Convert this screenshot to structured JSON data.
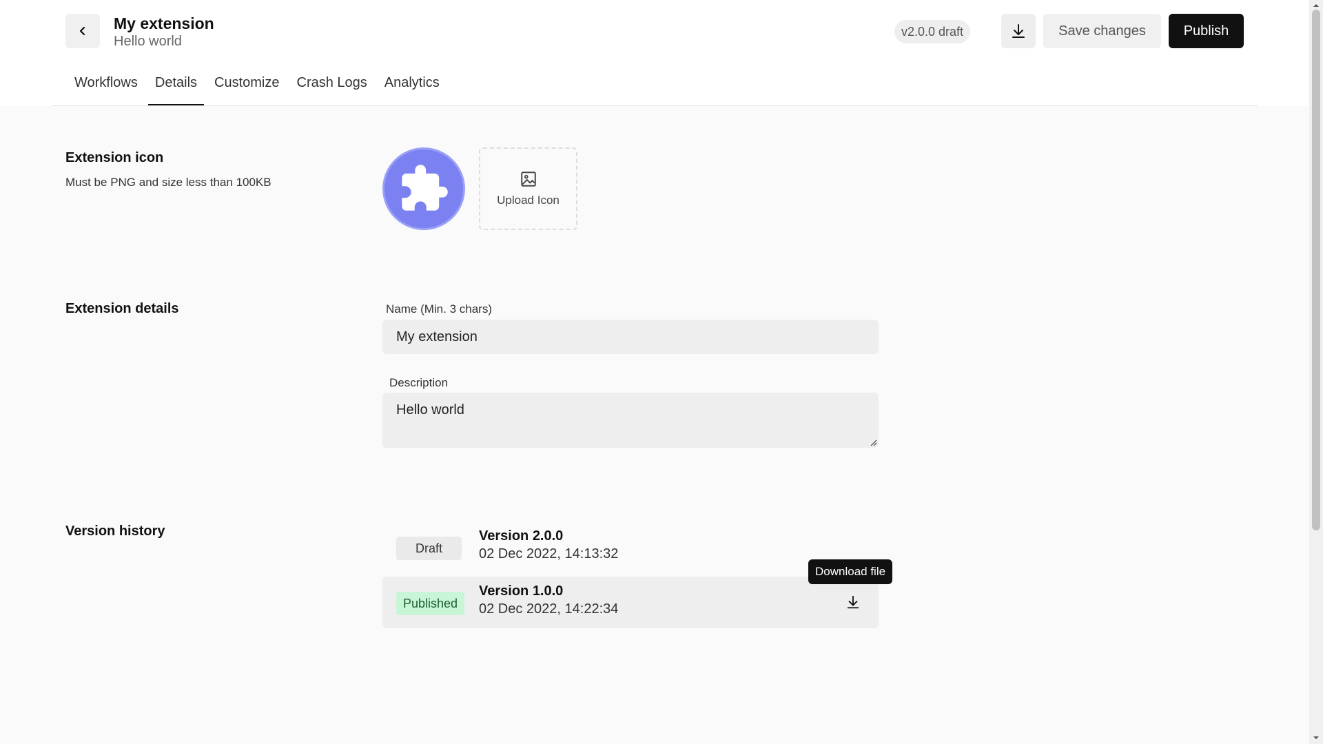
{
  "header": {
    "title": "My extension",
    "subtitle": "Hello world",
    "version_badge": "v2.0.0 draft",
    "save_label": "Save changes",
    "publish_label": "Publish"
  },
  "tabs": [
    {
      "label": "Workflows",
      "active": false
    },
    {
      "label": "Details",
      "active": true
    },
    {
      "label": "Customize",
      "active": false
    },
    {
      "label": "Crash Logs",
      "active": false
    },
    {
      "label": "Analytics",
      "active": false
    }
  ],
  "icon_section": {
    "title": "Extension icon",
    "description": "Must be PNG and size less than 100KB",
    "upload_label": "Upload Icon",
    "icon_color": "#7b81f0"
  },
  "details_section": {
    "title": "Extension details",
    "name_label": "Name (Min. 3 chars)",
    "name_value": "My extension",
    "description_label": "Description",
    "description_value": "Hello world"
  },
  "version_section": {
    "title": "Version history",
    "versions": [
      {
        "status": "Draft",
        "name": "Version 2.0.0",
        "date": "02 Dec 2022, 14:13:32"
      },
      {
        "status": "Published",
        "name": "Version 1.0.0",
        "date": "02 Dec 2022, 14:22:34"
      }
    ],
    "tooltip": "Download file"
  }
}
